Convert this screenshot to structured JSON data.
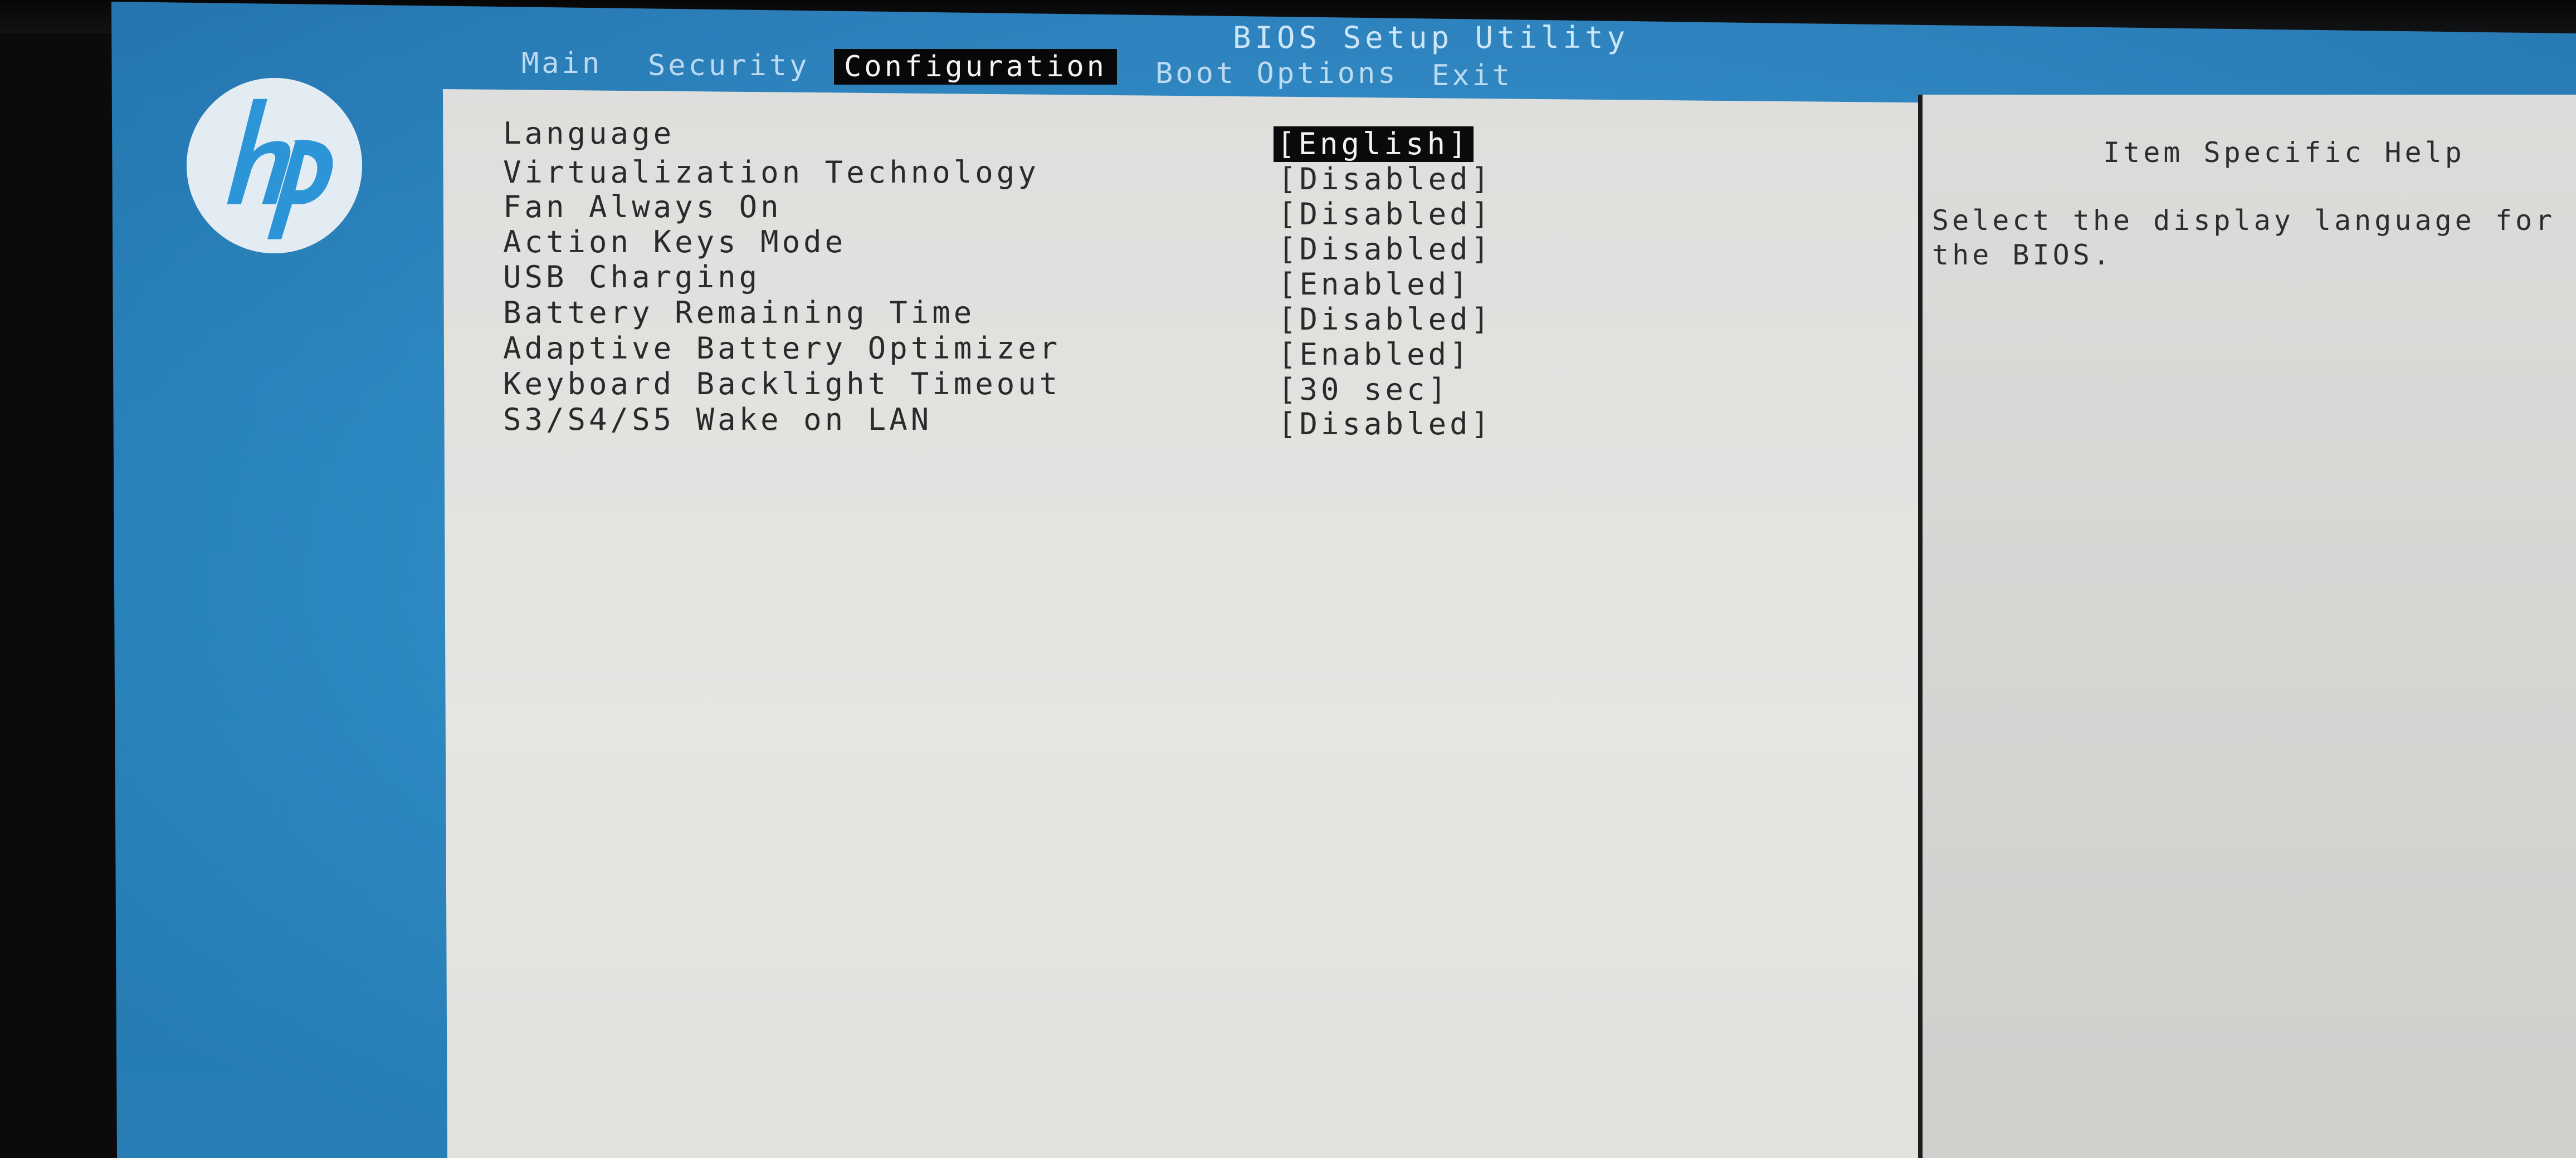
{
  "header": {
    "title": "BIOS Setup Utility",
    "tabs": [
      {
        "label": "Main"
      },
      {
        "label": "Security"
      },
      {
        "label": "Configuration",
        "active": true
      },
      {
        "label": "Boot Options"
      },
      {
        "label": "Exit"
      }
    ]
  },
  "logo": {
    "text": "hp"
  },
  "settings": [
    {
      "label": "Language",
      "value": "[English]",
      "selected": true
    },
    {
      "label": "Virtualization Technology",
      "value": "[Disabled]"
    },
    {
      "label": "Fan Always On",
      "value": "[Disabled]"
    },
    {
      "label": "Action Keys Mode",
      "value": "[Disabled]"
    },
    {
      "label": "USB Charging",
      "value": "[Enabled]"
    },
    {
      "label": "Battery Remaining Time",
      "value": "[Disabled]"
    },
    {
      "label": "Adaptive Battery Optimizer",
      "value": "[Enabled]"
    },
    {
      "label": "Keyboard Backlight Timeout",
      "value": "[30 sec]"
    },
    {
      "label": "S3/S4/S5 Wake on LAN",
      "value": "[Disabled]"
    }
  ],
  "help": {
    "title": "Item Specific Help",
    "text": "Select the display language for the BIOS."
  },
  "colors": {
    "frame_blue": "#2b95d7",
    "panel_gray": "#e2e2df",
    "highlight": "#0a0a0c"
  }
}
